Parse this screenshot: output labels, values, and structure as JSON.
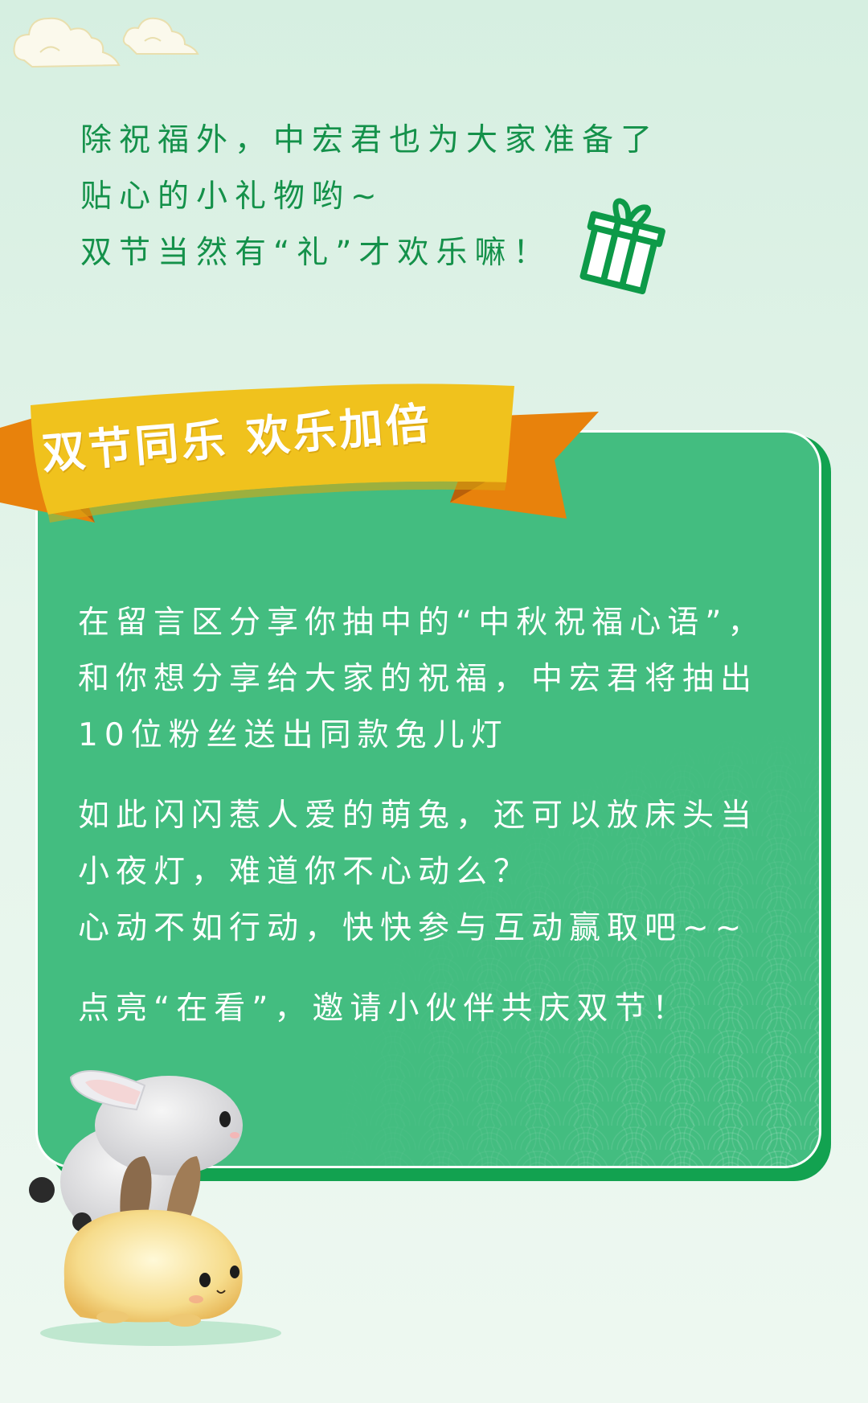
{
  "intro": {
    "lines": [
      "除祝福外，中宏君也为大家准备了",
      "贴心的小礼物哟~",
      "双节当然有“礼”才欢乐嘛！"
    ]
  },
  "banner": {
    "title": "双节同乐 欢乐加倍"
  },
  "card": {
    "paragraphs": [
      [
        "在留言区分享你抽中的“中秋祝福心语”，",
        "和你想分享给大家的祝福，中宏君将抽出",
        "10位粉丝送出同款兔儿灯"
      ],
      [
        "如此闪闪惹人爱的萌兔，还可以放床头当",
        "小夜灯，难道你不心动么？",
        "心动不如行动，快快参与互动赢取吧~~"
      ],
      [
        "点亮“在看”，邀请小伙伴共庆双节！"
      ]
    ]
  },
  "icons": {
    "gift": "gift-icon",
    "clouds": "cloud-decoration-icon",
    "bunnies": "bunny-lamp-illustration"
  },
  "colors": {
    "page_background": "#d6efe1",
    "intro_text": "#14914a",
    "card_fill": "#43bd80",
    "card_shadow": "#12a250",
    "ribbon_yellow": "#f0c21d",
    "ribbon_orange": "#e8820c",
    "card_text": "#ffffff"
  }
}
